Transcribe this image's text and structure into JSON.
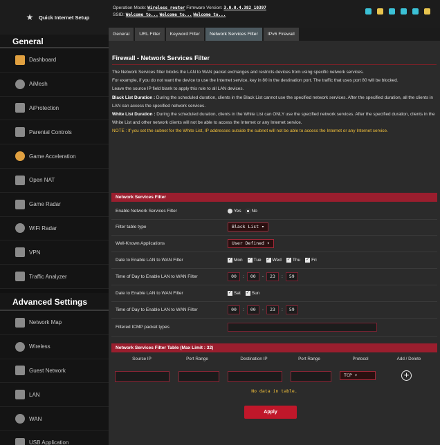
{
  "quick_setup": {
    "label": "Quick Internet Setup"
  },
  "sidebar": {
    "general_header": "General",
    "general_items": [
      {
        "label": "Dashboard",
        "icon": "dashboard-icon"
      },
      {
        "label": "AiMesh",
        "icon": "aimesh-icon"
      },
      {
        "label": "AiProtection",
        "icon": "shield-icon"
      },
      {
        "label": "Parental Controls",
        "icon": "family-icon"
      },
      {
        "label": "Game Acceleration",
        "icon": "rocket-icon"
      },
      {
        "label": "Open NAT",
        "icon": "open-nat-icon"
      },
      {
        "label": "Game Radar",
        "icon": "radar-icon"
      },
      {
        "label": "WiFi Radar",
        "icon": "wifi-radar-icon"
      },
      {
        "label": "VPN",
        "icon": "vpn-icon"
      },
      {
        "label": "Traffic Analyzer",
        "icon": "traffic-icon"
      }
    ],
    "advanced_header": "Advanced Settings",
    "advanced_items": [
      {
        "label": "Network Map",
        "icon": "network-map-icon"
      },
      {
        "label": "Wireless",
        "icon": "wireless-icon"
      },
      {
        "label": "Guest Network",
        "icon": "guest-icon"
      },
      {
        "label": "LAN",
        "icon": "lan-icon"
      },
      {
        "label": "WAN",
        "icon": "wan-icon"
      },
      {
        "label": "USB Application",
        "icon": "usb-icon"
      }
    ]
  },
  "header": {
    "op_mode_label": "Operation Mode:",
    "op_mode_value": "Wireless router",
    "fw_label": "Firmware Version:",
    "fw_value": "3.0.0.4.382_10397",
    "ssid_label": "SSID:",
    "ssid_values": [
      "Welcome to...",
      "Welcome to...",
      "Welcome to..."
    ]
  },
  "tabs": [
    "General",
    "URL Filter",
    "Keyword Filter",
    "Network Services Filter",
    "IPv6 Firewall"
  ],
  "page": {
    "title": "Firewall - Network Services Filter",
    "desc1": "The Network Services filter blocks the LAN to WAN packet exchanges and restricts devices from using specific network services.",
    "desc2": "For example, if you do not want the device to use the Internet service, key in 80 in the destination port. The traffic that uses port 80 will be blocked.",
    "desc3": "Leave the source IP field blank to apply this rule to all LAN devices.",
    "black_label": "Black List Duration :",
    "black_text": " During the scheduled duration, clients in the Black List cannot use the specified network services. After the specified duration, all the clients in LAN can access the specified network services.",
    "white_label": "White List Duration :",
    "white_text": " During the scheduled duration, clients in the White List can ONLY use the specified network services. After the specified duration, clients in the White List and other network clients will not be able to access the Internet or any Internet service.",
    "note": "NOTE : If you set the subnet for the White List, IP addresses outside the subnet will not be able to access the Internet or any Internet service."
  },
  "filter": {
    "header": "Network Services Filter",
    "enable_label": "Enable Network Services Filter",
    "yes": "Yes",
    "no": "No",
    "table_type_label": "Filter table type",
    "table_type_value": "Black List",
    "wk_label": "Well-Known Applications",
    "wk_value": "User Defined",
    "date1_label": "Date to Enable LAN to WAN Filter",
    "days1": [
      "Mon",
      "Tue",
      "Wed",
      "Thu",
      "Fri"
    ],
    "time1_label": "Time of Day to Enable LAN to WAN Filter",
    "time1": [
      "00",
      "00",
      "23",
      "59"
    ],
    "date2_label": "Date to Enable LAN to WAN Filter",
    "days2": [
      "Sat",
      "Sun"
    ],
    "time2_label": "Time of Day to Enable LAN to WAN Filter",
    "time2": [
      "00",
      "00",
      "23",
      "59"
    ],
    "icmp_label": "Filtered ICMP packet types"
  },
  "table": {
    "header": "Network Services Filter Table (Max Limit : 32)",
    "columns": [
      "Source IP",
      "Port Range",
      "Destination IP",
      "Port Range",
      "Protocol",
      "Add / Delete"
    ],
    "protocol": "TCP",
    "empty": "No data in table."
  },
  "apply_label": "Apply"
}
